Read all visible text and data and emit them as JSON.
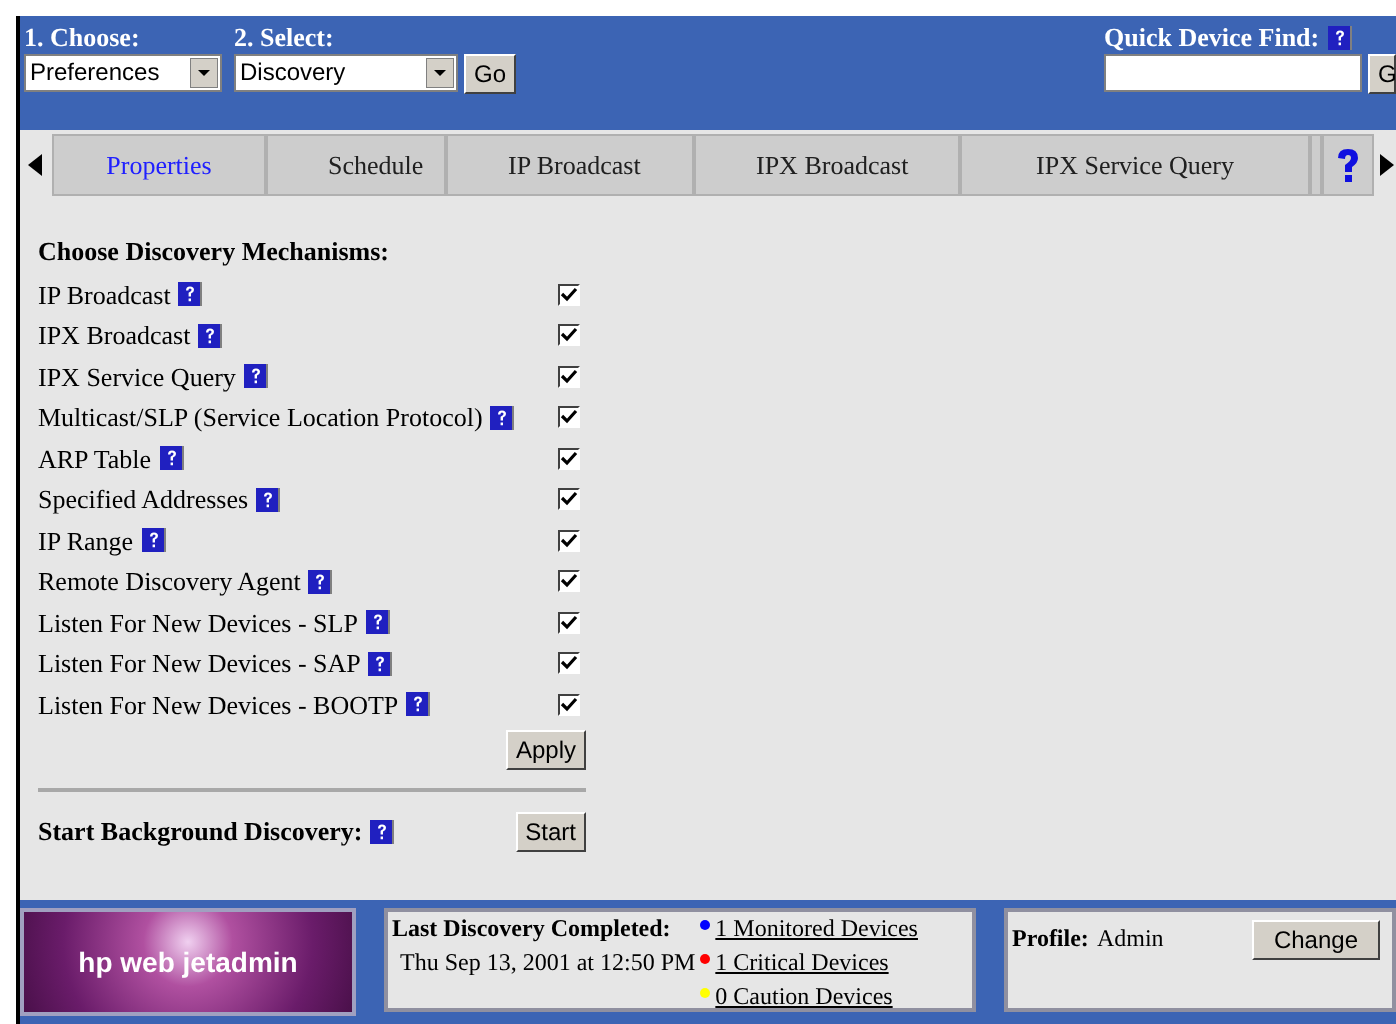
{
  "header": {
    "choose_label": "1. Choose:",
    "choose_value": "Preferences",
    "select_label": "2. Select:",
    "select_value": "Discovery",
    "go": "Go",
    "quick_find_label": "Quick Device Find:",
    "quick_find_go": "G"
  },
  "tabs": [
    {
      "label": "Properties",
      "selected": true
    },
    {
      "label": "Schedule",
      "selected": false
    },
    {
      "label": "IP Broadcast",
      "selected": false
    },
    {
      "label": "IPX Broadcast",
      "selected": false
    },
    {
      "label": "IPX Service Query",
      "selected": false
    }
  ],
  "heading": "Choose Discovery Mechanisms:",
  "mechanisms": [
    {
      "label": "IP Broadcast",
      "checked": true
    },
    {
      "label": "IPX Broadcast",
      "checked": true
    },
    {
      "label": "IPX Service Query",
      "checked": true
    },
    {
      "label": "Multicast/SLP (Service Location Protocol)",
      "checked": true
    },
    {
      "label": "ARP Table",
      "checked": true
    },
    {
      "label": "Specified Addresses",
      "checked": true
    },
    {
      "label": "IP Range",
      "checked": true
    },
    {
      "label": "Remote Discovery Agent",
      "checked": true
    },
    {
      "label": "Listen For New Devices - SLP",
      "checked": true
    },
    {
      "label": "Listen For New Devices - SAP",
      "checked": true
    },
    {
      "label": "Listen For New Devices - BOOTP",
      "checked": true
    }
  ],
  "apply": "Apply",
  "background": {
    "label": "Start Background Discovery:",
    "button": "Start"
  },
  "footer": {
    "logo": "hp web jetadmin",
    "last_label": "Last Discovery Completed:",
    "last_date": "Thu Sep 13, 2001 at 12:50 PM",
    "devices": [
      {
        "text": "1 Monitored Devices",
        "color": "#0000ff"
      },
      {
        "text": "1 Critical Devices",
        "color": "#ff0000"
      },
      {
        "text": "0 Caution Devices",
        "color": "#ffff00"
      }
    ],
    "profile_label": "Profile:",
    "profile_value": "Admin",
    "change": "Change"
  }
}
